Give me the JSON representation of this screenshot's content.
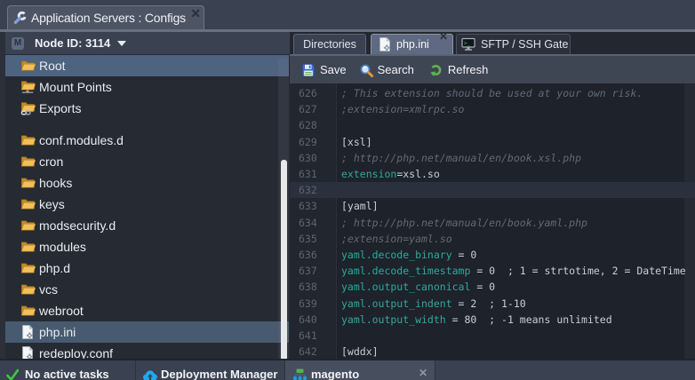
{
  "window_tab": {
    "title": "Application Servers : Configs",
    "close_label": "✕"
  },
  "sidebar": {
    "header": {
      "badge": "M",
      "label": "Node ID: 3114"
    },
    "groups": [
      {
        "items": [
          {
            "label": "Root",
            "icon": "folder-open",
            "selected": "root"
          },
          {
            "label": "Mount Points",
            "icon": "folder-mount",
            "selected": ""
          },
          {
            "label": "Exports",
            "icon": "folder-exports",
            "selected": ""
          }
        ]
      },
      {
        "items": [
          {
            "label": "conf.modules.d",
            "icon": "folder-open",
            "selected": ""
          },
          {
            "label": "cron",
            "icon": "folder-open",
            "selected": ""
          },
          {
            "label": "hooks",
            "icon": "folder-open",
            "selected": ""
          },
          {
            "label": "keys",
            "icon": "folder-open",
            "selected": ""
          },
          {
            "label": "modsecurity.d",
            "icon": "folder-open",
            "selected": ""
          },
          {
            "label": "modules",
            "icon": "folder-open",
            "selected": ""
          },
          {
            "label": "php.d",
            "icon": "folder-open",
            "selected": ""
          },
          {
            "label": "vcs",
            "icon": "folder-open",
            "selected": ""
          },
          {
            "label": "webroot",
            "icon": "folder-open",
            "selected": ""
          },
          {
            "label": "php.ini",
            "icon": "file-config",
            "selected": "file"
          },
          {
            "label": "redeploy.conf",
            "icon": "file-config",
            "selected": ""
          }
        ]
      }
    ]
  },
  "editor": {
    "tabs": [
      {
        "id": "directories",
        "label": "Directories",
        "icon": "",
        "active": false,
        "closable": false
      },
      {
        "id": "phpini",
        "label": "php.ini",
        "icon": "file-config",
        "active": true,
        "closable": true,
        "close_label": "✕"
      },
      {
        "id": "sftp",
        "label": "SFTP / SSH Gate",
        "icon": "terminal",
        "active": false,
        "closable": false
      }
    ],
    "toolbar": [
      {
        "id": "save",
        "label": "Save",
        "icon": "save"
      },
      {
        "id": "search",
        "label": "Search",
        "icon": "search"
      },
      {
        "id": "refresh",
        "label": "Refresh",
        "icon": "refresh"
      }
    ],
    "lines": [
      {
        "n": "626",
        "current": false,
        "segments": [
          {
            "t": "; This extension should be used at your own risk.",
            "c": "comment"
          }
        ]
      },
      {
        "n": "627",
        "current": false,
        "segments": [
          {
            "t": ";extension=xmlrpc.so",
            "c": "comment"
          }
        ]
      },
      {
        "n": "628",
        "current": false,
        "segments": []
      },
      {
        "n": "629",
        "current": false,
        "segments": [
          {
            "t": "[xsl]",
            "c": "plain"
          }
        ]
      },
      {
        "n": "630",
        "current": false,
        "segments": [
          {
            "t": "; http://php.net/manual/en/book.xsl.php",
            "c": "comment"
          }
        ]
      },
      {
        "n": "631",
        "current": false,
        "segments": [
          {
            "t": "extension",
            "c": "prop"
          },
          {
            "t": "=xsl.so",
            "c": "plain"
          }
        ]
      },
      {
        "n": "632",
        "current": true,
        "segments": []
      },
      {
        "n": "633",
        "current": false,
        "segments": [
          {
            "t": "[yaml]",
            "c": "plain"
          }
        ]
      },
      {
        "n": "634",
        "current": false,
        "segments": [
          {
            "t": "; http://php.net/manual/en/book.yaml.php",
            "c": "comment"
          }
        ]
      },
      {
        "n": "635",
        "current": false,
        "segments": [
          {
            "t": ";extension=yaml.so",
            "c": "comment"
          }
        ]
      },
      {
        "n": "636",
        "current": false,
        "segments": [
          {
            "t": "yaml.decode_binary",
            "c": "prop"
          },
          {
            "t": " = 0",
            "c": "plain"
          }
        ]
      },
      {
        "n": "637",
        "current": false,
        "segments": [
          {
            "t": "yaml.decode_timestamp",
            "c": "prop"
          },
          {
            "t": " = 0  ; 1 = strtotime, 2 = DateTime",
            "c": "plain"
          }
        ]
      },
      {
        "n": "638",
        "current": false,
        "segments": [
          {
            "t": "yaml.output_canonical",
            "c": "prop"
          },
          {
            "t": " = 0",
            "c": "plain"
          }
        ]
      },
      {
        "n": "639",
        "current": false,
        "segments": [
          {
            "t": "yaml.output_indent",
            "c": "prop"
          },
          {
            "t": " = 2  ; 1-10",
            "c": "plain"
          }
        ]
      },
      {
        "n": "640",
        "current": false,
        "segments": [
          {
            "t": "yaml.output_width",
            "c": "prop"
          },
          {
            "t": " = 80  ; -1 means unlimited",
            "c": "plain"
          }
        ]
      },
      {
        "n": "641",
        "current": false,
        "segments": []
      },
      {
        "n": "642",
        "current": false,
        "segments": [
          {
            "t": "[wddx]",
            "c": "plain"
          }
        ]
      }
    ]
  },
  "taskbar": {
    "status": {
      "label": "No active tasks",
      "icon": "check"
    },
    "items": [
      {
        "id": "deployment",
        "label": "Deployment Manager",
        "icon": "cloud-upload",
        "active": false,
        "closable": false
      },
      {
        "id": "magento",
        "label": "magento",
        "icon": "environment",
        "active": true,
        "closable": true,
        "close_label": "✕"
      }
    ]
  },
  "colors": {
    "chrome": "#3a4150",
    "band": "#68707f",
    "tree_bg": "#262a33",
    "selected_row": "#4d6380",
    "selected_file_row": "#475a70",
    "editor_bg": "#1e222a",
    "gutter_bg": "#22262e",
    "current_line": "#2a303d",
    "comment": "#606a78",
    "plain_text": "#c9cfd7",
    "property": "#32a89c",
    "toolbar_bg": "#3e4553",
    "active_tab": "#5f6a82",
    "taskbar_bg": "#3a4150",
    "check_green": "#3ec63e",
    "cloud_blue": "#1caaf2"
  }
}
